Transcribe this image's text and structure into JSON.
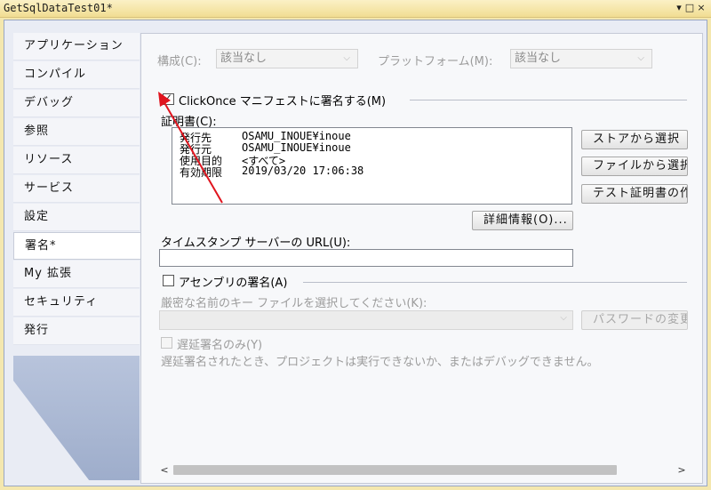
{
  "window": {
    "title": "GetSqlDataTest01*",
    "controls": [
      "▾",
      "□",
      "×"
    ]
  },
  "tabs": [
    {
      "label": "アプリケーション",
      "active": false
    },
    {
      "label": "コンパイル",
      "active": false
    },
    {
      "label": "デバッグ",
      "active": false
    },
    {
      "label": "参照",
      "active": false
    },
    {
      "label": "リソース",
      "active": false
    },
    {
      "label": "サービス",
      "active": false
    },
    {
      "label": "設定",
      "active": false
    },
    {
      "label": "署名*",
      "active": true
    },
    {
      "label": "My 拡張",
      "active": false
    },
    {
      "label": "セキュリティ",
      "active": false
    },
    {
      "label": "発行",
      "active": false
    }
  ],
  "config": {
    "config_label": "構成(C):",
    "config_value": "該当なし",
    "platform_label": "プラットフォーム(M):",
    "platform_value": "該当なし"
  },
  "clickonce": {
    "checkbox_label": "ClickOnce マニフェストに署名する(M)",
    "checked": true,
    "cert_label": "証明書(C):",
    "cert": [
      {
        "key": "発行先",
        "value": "OSAMU_INOUE¥inoue"
      },
      {
        "key": "発行元",
        "value": "OSAMU_INOUE¥inoue"
      },
      {
        "key": "使用目的",
        "value": "<すべて>"
      },
      {
        "key": "有効期限",
        "value": "2019/03/20 17:06:38"
      }
    ],
    "btn_store": "ストアから選択",
    "btn_file": "ファイルから選択",
    "btn_test": "テスト証明書の作",
    "btn_details": "詳細情報(O)...",
    "timestamp_label": "タイムスタンプ サーバーの URL(U):",
    "timestamp_value": ""
  },
  "assembly": {
    "checkbox_label": "アセンブリの署名(A)",
    "checked": false,
    "key_label": "厳密な名前のキー ファイルを選択してください(K):",
    "btn_password": "パスワードの変更",
    "delay_label": "遅延署名のみ(Y)",
    "delay_note": "遅延署名されたとき、プロジェクトは実行できないか、またはデバッグできません。"
  },
  "colors": {
    "arrow": "#e0141e",
    "frame": "#e9ecf4",
    "titlebar": "#f4e7ae"
  }
}
